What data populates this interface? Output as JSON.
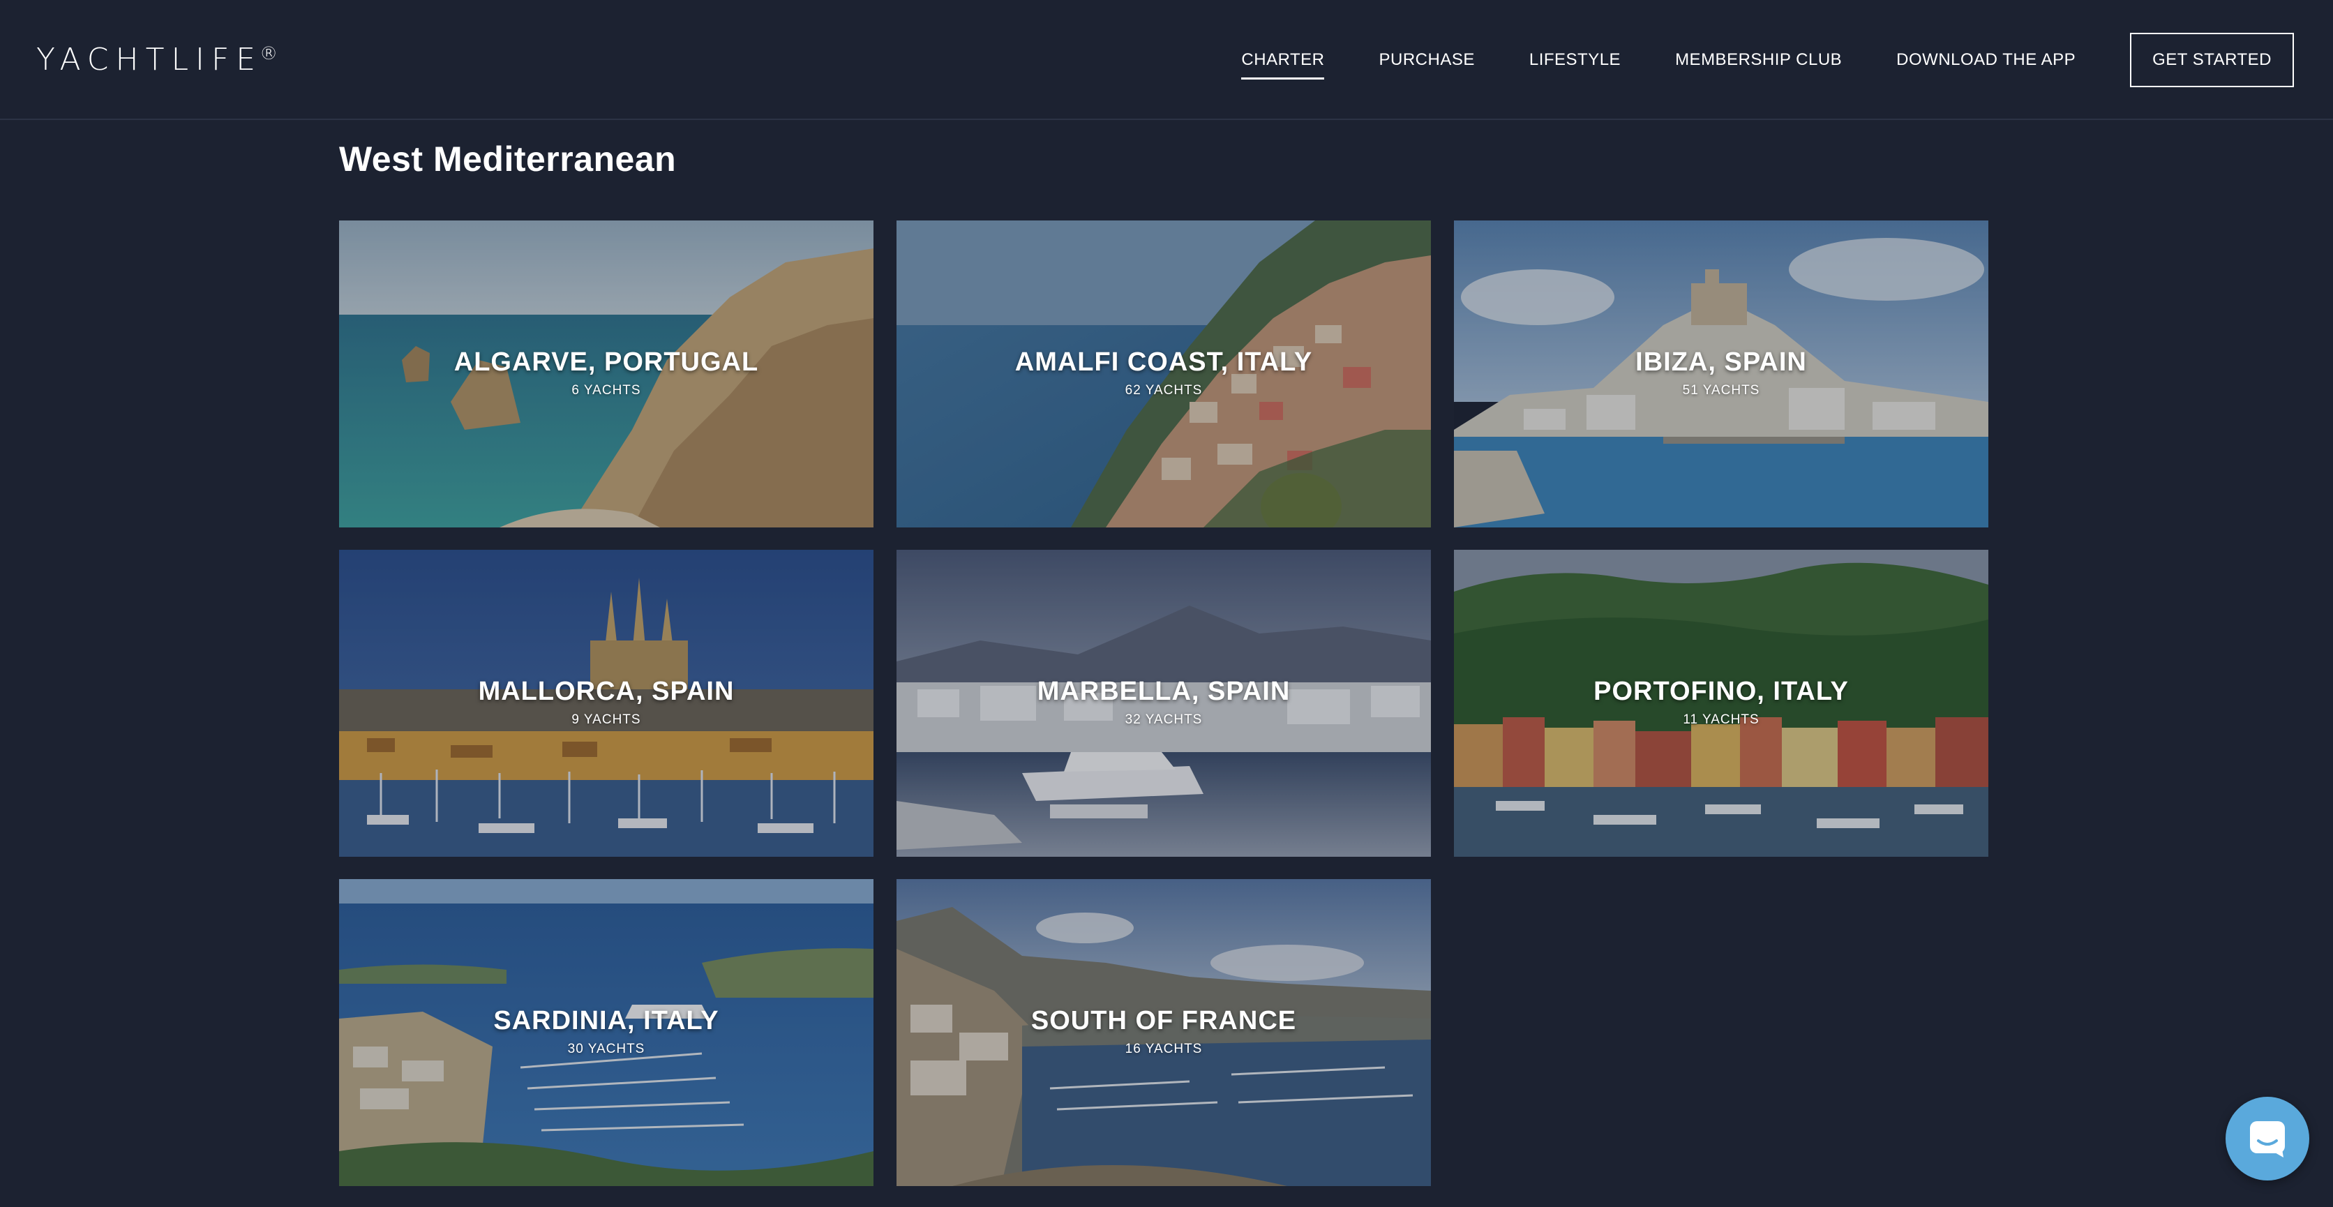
{
  "brand": {
    "logo_text": "YACHTLIFE",
    "registered_mark": "®"
  },
  "nav": {
    "items": [
      {
        "label": "CHARTER",
        "active": true
      },
      {
        "label": "PURCHASE",
        "active": false
      },
      {
        "label": "LIFESTYLE",
        "active": false
      },
      {
        "label": "MEMBERSHIP CLUB",
        "active": false
      },
      {
        "label": "DOWNLOAD THE APP",
        "active": false
      }
    ],
    "cta_label": "GET STARTED"
  },
  "section": {
    "title": "West Mediterranean"
  },
  "destinations": [
    {
      "name": "ALGARVE, PORTUGAL",
      "count": "6 YACHTS",
      "icon": "coastal-cliffs-photo"
    },
    {
      "name": "AMALFI COAST, ITALY",
      "count": "62 YACHTS",
      "icon": "hillside-town-photo"
    },
    {
      "name": "IBIZA, SPAIN",
      "count": "51 YACHTS",
      "icon": "old-town-harbour-photo"
    },
    {
      "name": "MALLORCA, SPAIN",
      "count": "9 YACHTS",
      "icon": "cathedral-marina-photo"
    },
    {
      "name": "MARBELLA, SPAIN",
      "count": "32 YACHTS",
      "icon": "marina-mountains-photo"
    },
    {
      "name": "PORTOFINO, ITALY",
      "count": "11 YACHTS",
      "icon": "colorful-harbour-photo"
    },
    {
      "name": "SARDINIA, ITALY",
      "count": "30 YACHTS",
      "icon": "bay-marina-photo"
    },
    {
      "name": "SOUTH OF FRANCE",
      "count": "16 YACHTS",
      "icon": "monaco-harbour-photo"
    }
  ],
  "chat": {
    "icon": "chat-icon"
  },
  "colors": {
    "background": "#1c2231",
    "chat_button": "#5aa9dc",
    "text": "#ffffff"
  }
}
